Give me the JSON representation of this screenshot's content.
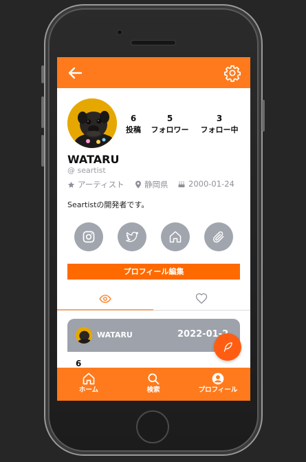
{
  "profile": {
    "username": "WATARU",
    "handle": "@ seartist",
    "role": "アーティスト",
    "location": "静岡県",
    "birthday": "2000-01-24",
    "bio": "Seartistの開発者です。"
  },
  "stats": [
    {
      "value": "6",
      "label": "投稿"
    },
    {
      "value": "5",
      "label": "フォロワー"
    },
    {
      "value": "3",
      "label": "フォロー中"
    }
  ],
  "social_icons": [
    "instagram-icon",
    "twitter-icon",
    "home-icon",
    "paperclip-icon"
  ],
  "edit_button_label": "プロフィール編集",
  "tabs": [
    {
      "icon": "eye-icon",
      "active": true
    },
    {
      "icon": "heart-icon",
      "active": false
    }
  ],
  "post_card": {
    "author": "WATARU",
    "date": "2022-01-2"
  },
  "post_count": "6",
  "bottom_nav": [
    {
      "label": "ホーム",
      "icon": "home-icon"
    },
    {
      "label": "検索",
      "icon": "search-icon"
    },
    {
      "label": "プロフィール",
      "icon": "account-icon"
    }
  ],
  "colors": {
    "accent": "#ff7a1c",
    "button": "#ff6a00",
    "fab": "#ff5d12",
    "social_bg": "#a1a5ae",
    "card_bg": "#9da2ab"
  }
}
